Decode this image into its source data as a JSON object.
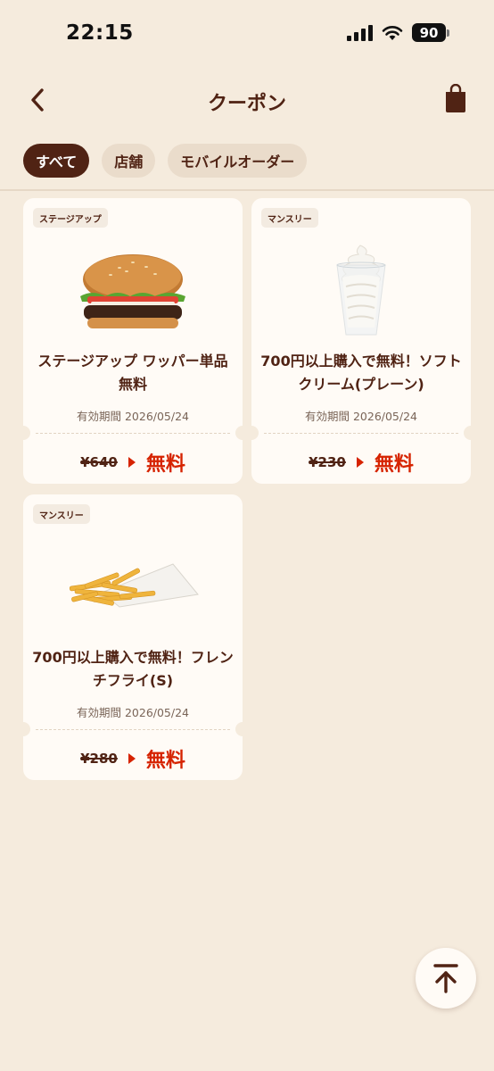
{
  "status": {
    "time": "22:15",
    "battery": "90"
  },
  "header": {
    "title": "クーポン"
  },
  "tabs": [
    {
      "label": "すべて",
      "active": true
    },
    {
      "label": "店舗",
      "active": false
    },
    {
      "label": "モバイルオーダー",
      "active": false
    }
  ],
  "coupons": [
    {
      "badge": "ステージアップ",
      "title": "ステージアップ ワッパー単品無料",
      "expiry": "有効期間 2026/05/24",
      "price_old": "¥640",
      "price_new": "無料",
      "image": "burger"
    },
    {
      "badge": "マンスリー",
      "title": "700円以上購入で無料！ソフトクリーム(プレーン)",
      "expiry": "有効期間 2026/05/24",
      "price_old": "¥230",
      "price_new": "無料",
      "image": "soft-cream"
    },
    {
      "badge": "マンスリー",
      "title": "700円以上購入で無料！フレンチフライ(S)",
      "expiry": "有効期間 2026/05/24",
      "price_old": "¥280",
      "price_new": "無料",
      "image": "fries"
    }
  ],
  "colors": {
    "brand_brown": "#502314",
    "accent_red": "#d62300",
    "background": "#f5ebdd"
  }
}
